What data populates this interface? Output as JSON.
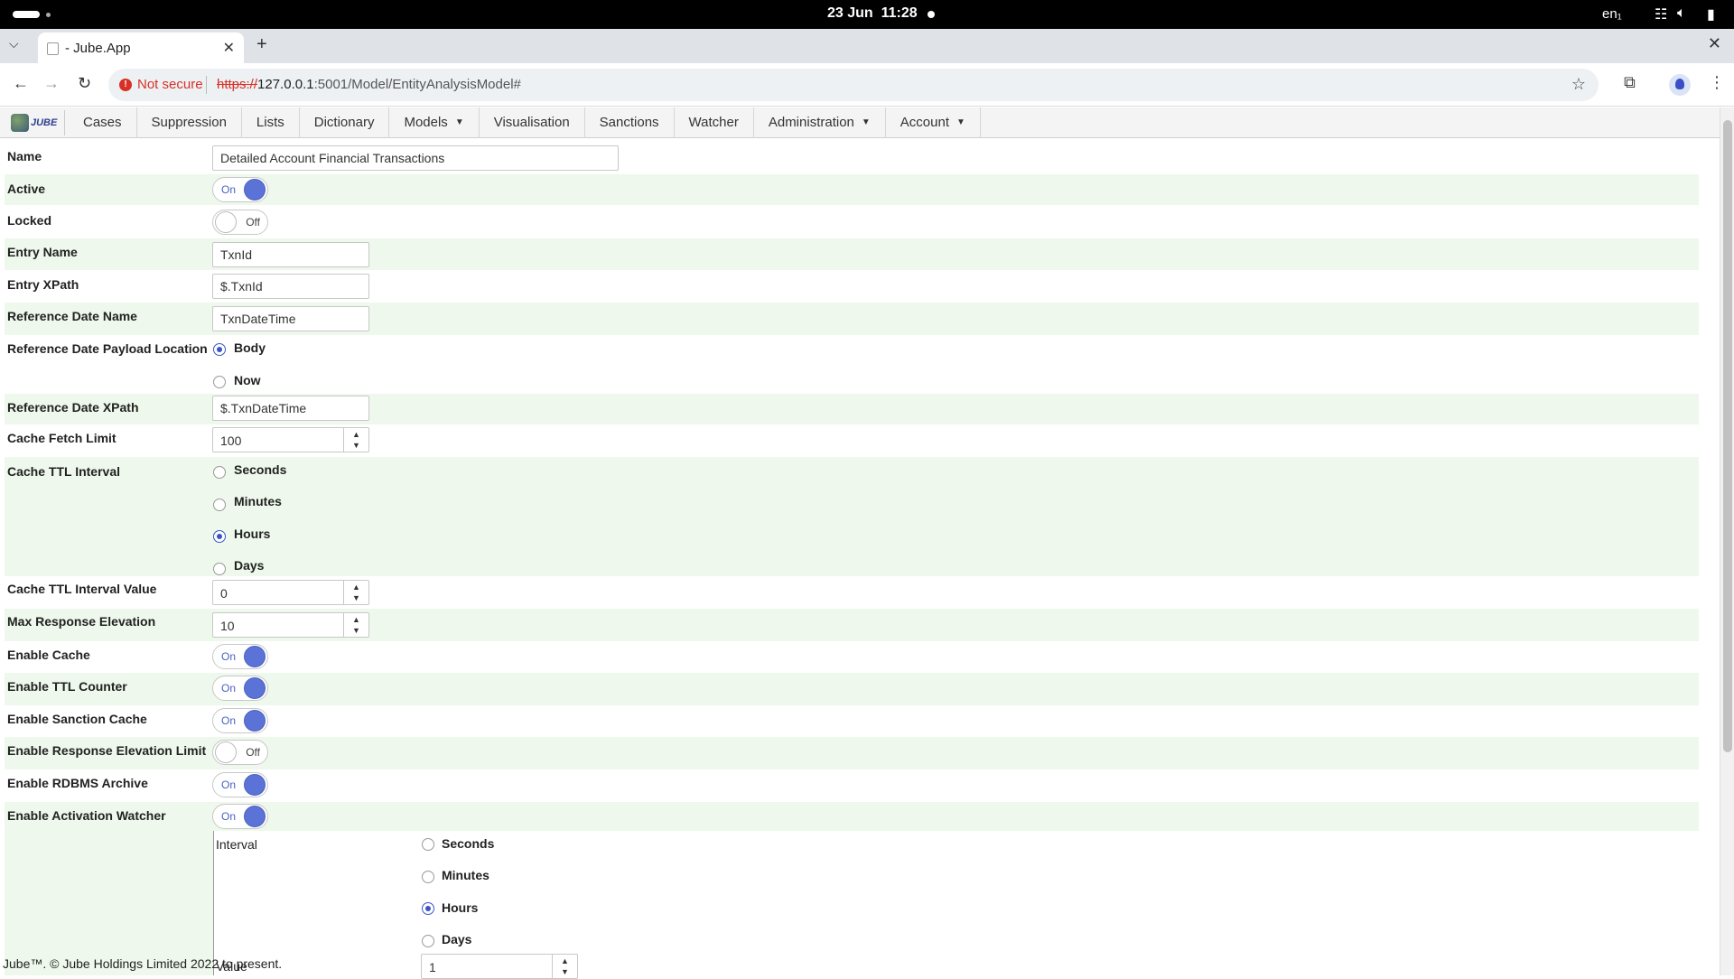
{
  "system": {
    "date": "23 Jun",
    "time": "11:28",
    "lang": "en₁"
  },
  "browser": {
    "tab_title": "- Jube.App",
    "not_secure": "Not secure",
    "url_scheme": "https://",
    "url_host": "127.0.0.1",
    "url_path": ":5001/Model/EntityAnalysisModel#"
  },
  "nav": {
    "logo_text": "JUBE",
    "items": [
      "Cases",
      "Suppression",
      "Lists",
      "Dictionary",
      "Models",
      "Visualisation",
      "Sanctions",
      "Watcher",
      "Administration",
      "Account"
    ]
  },
  "form": {
    "name": {
      "label": "Name",
      "value": "Detailed Account Financial Transactions"
    },
    "active": {
      "label": "Active",
      "state": "On"
    },
    "locked": {
      "label": "Locked",
      "state": "Off"
    },
    "entry_name": {
      "label": "Entry Name",
      "value": "TxnId"
    },
    "entry_xpath": {
      "label": "Entry XPath",
      "value": "$.TxnId"
    },
    "ref_date_name": {
      "label": "Reference Date Name",
      "value": "TxnDateTime"
    },
    "ref_date_payload": {
      "label": "Reference Date Payload Location",
      "options": [
        "Body",
        "Now"
      ],
      "selected": "Body"
    },
    "ref_date_xpath": {
      "label": "Reference Date XPath",
      "value": "$.TxnDateTime"
    },
    "cache_fetch_limit": {
      "label": "Cache Fetch Limit",
      "value": "100"
    },
    "cache_ttl_interval": {
      "label": "Cache TTL Interval",
      "options": [
        "Seconds",
        "Minutes",
        "Hours",
        "Days"
      ],
      "selected": "Hours"
    },
    "cache_ttl_value": {
      "label": "Cache TTL Interval Value",
      "value": "0"
    },
    "max_response_elevation": {
      "label": "Max Response Elevation",
      "value": "10"
    },
    "enable_cache": {
      "label": "Enable Cache",
      "state": "On"
    },
    "enable_ttl_counter": {
      "label": "Enable TTL Counter",
      "state": "On"
    },
    "enable_sanction_cache": {
      "label": "Enable Sanction Cache",
      "state": "On"
    },
    "enable_response_elevation_limit": {
      "label": "Enable Response Elevation Limit",
      "state": "Off"
    },
    "enable_rdbms_archive": {
      "label": "Enable RDBMS Archive",
      "state": "On"
    },
    "enable_activation_watcher": {
      "label": "Enable Activation Watcher",
      "state": "On"
    },
    "watcher_interval": {
      "label": "Interval",
      "options": [
        "Seconds",
        "Minutes",
        "Hours",
        "Days"
      ],
      "selected": "Hours"
    },
    "watcher_value": {
      "label": "Value",
      "value": "1"
    }
  },
  "footer": "Jube™. © Jube Holdings Limited 2022 to present."
}
